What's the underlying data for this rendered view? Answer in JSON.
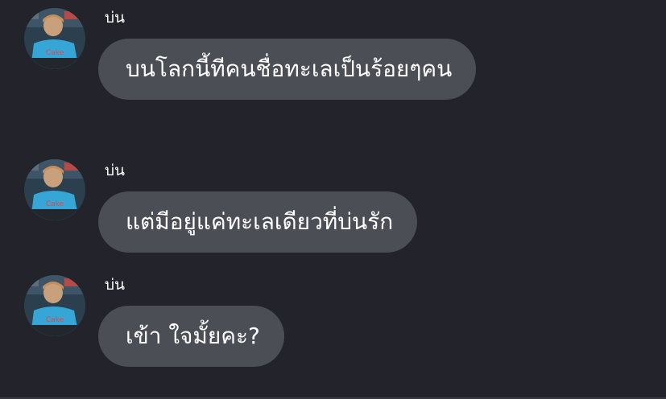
{
  "messages": [
    {
      "sender": "บ่น",
      "text": "บนโลกนี้ทีคนชื่อทะเลเป็นร้อยๆคน"
    },
    {
      "sender": "บ่น",
      "text": "แต่มีอยู่แค่ทะเลเดียวที่บ่นรัก"
    },
    {
      "sender": "บ่น",
      "text": "เข้า ใจมั้ยคะ?"
    }
  ],
  "colors": {
    "background": "#23242b",
    "bubble": "#4c4e56",
    "text": "#ffffff"
  },
  "icons": {
    "avatar": "avatar-photo"
  }
}
